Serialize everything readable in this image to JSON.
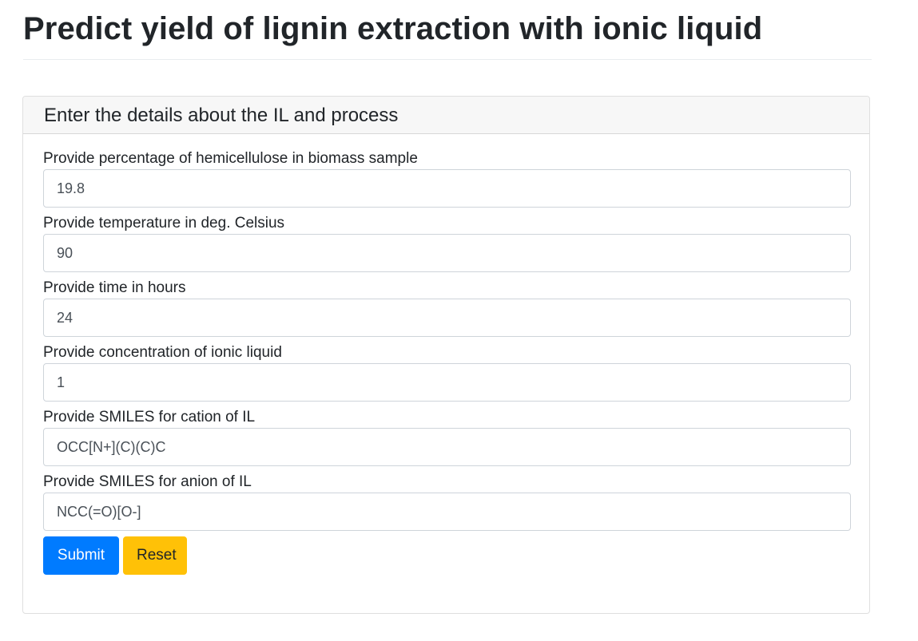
{
  "page": {
    "title": "Predict yield of lignin extraction with ionic liquid"
  },
  "card": {
    "header": "Enter the details about the IL and process"
  },
  "form": {
    "fields": [
      {
        "label": "Provide percentage of hemicellulose in biomass sample",
        "value": "19.8"
      },
      {
        "label": "Provide temperature in deg. Celsius",
        "value": "90"
      },
      {
        "label": "Provide time in hours",
        "value": "24"
      },
      {
        "label": "Provide concentration of ionic liquid",
        "value": "1"
      },
      {
        "label": "Provide SMILES for cation of IL",
        "value": "OCC[N+](C)(C)C"
      },
      {
        "label": "Provide SMILES for anion of IL",
        "value": "NCC(=O)[O-]"
      }
    ],
    "submit_label": "Submit",
    "reset_label": "Reset"
  },
  "colors": {
    "primary": "#007bff",
    "warning": "#ffc107",
    "card_header_bg": "#f7f7f7",
    "text": "#212529"
  }
}
